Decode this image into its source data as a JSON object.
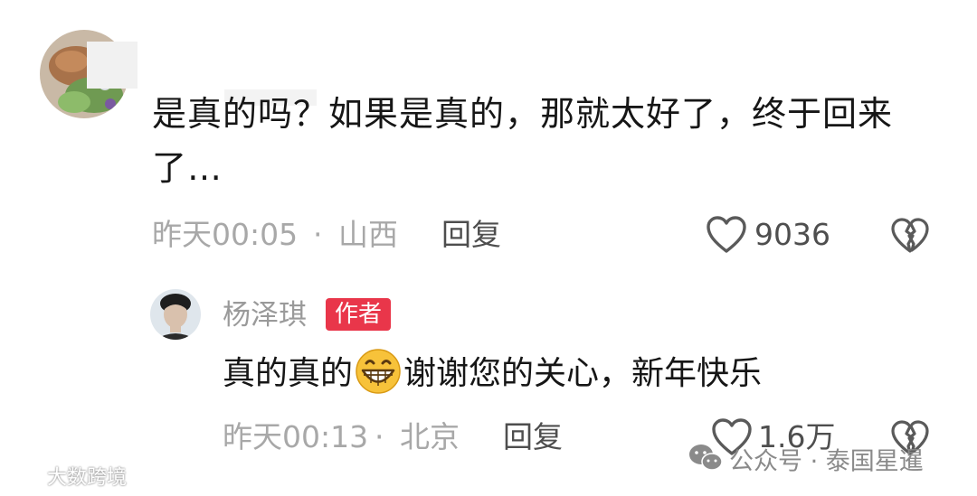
{
  "comment": {
    "text": "是真的吗？如果是真的，那就太好了，终于回来了…",
    "time": "昨天00:05",
    "separator": "·",
    "location": "山西",
    "reply_label": "回复",
    "like_count": "9036"
  },
  "reply": {
    "author": "杨泽琪",
    "badge": "作者",
    "text_before": "真的真的",
    "text_after": "谢谢您的关心，新年快乐",
    "time": "昨天00:13",
    "separator": "·",
    "location": "北京",
    "reply_label": "回复",
    "like_count": "1.6万"
  },
  "watermarks": {
    "left": "大数跨境",
    "right": "公众号 · 泰国星暹"
  },
  "colors": {
    "badge": "#e9364a",
    "meta": "#a8a8a8",
    "text": "#161616"
  }
}
